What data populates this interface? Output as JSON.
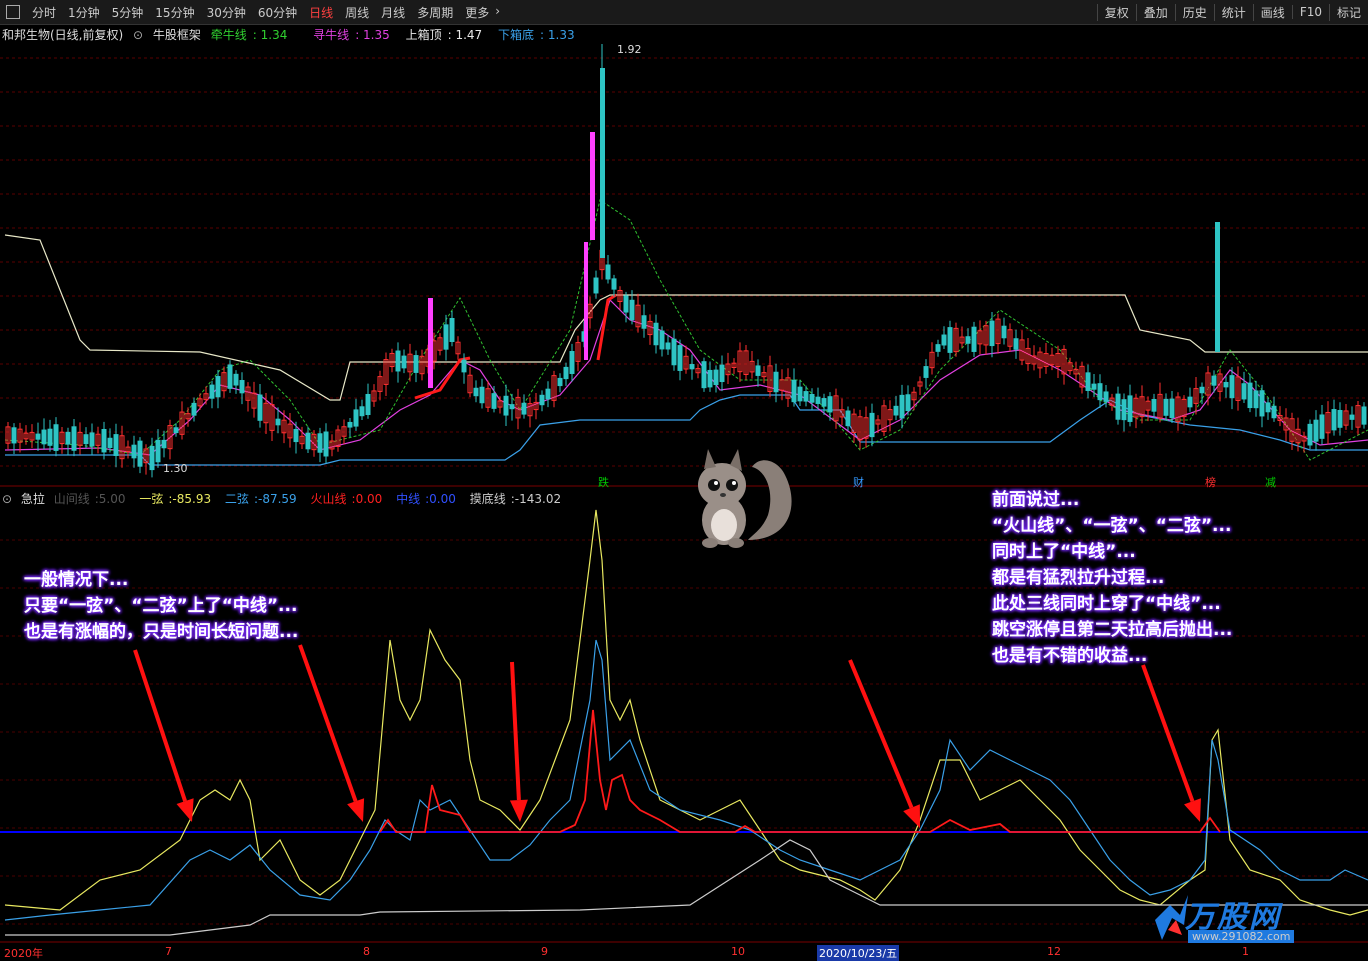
{
  "toolbar": {
    "periods": [
      "分时",
      "1分钟",
      "5分钟",
      "15分钟",
      "30分钟",
      "60分钟",
      "日线",
      "周线",
      "月线",
      "多周期",
      "更多"
    ],
    "active": "日线",
    "right_items": [
      "复权",
      "叠加",
      "历史",
      "统计",
      "画线",
      "F10",
      "标记"
    ]
  },
  "info": {
    "stock": "和邦生物(日线,前复权)",
    "indicator": "牛股框架",
    "l1_name": "牵牛线",
    "l1_val": "1.34",
    "l2_name": "寻牛线",
    "l2_val": "1.35",
    "l3_name": "上箱顶",
    "l3_val": "1.47",
    "l4_name": "下箱底",
    "l4_val": "1.33",
    "high_label": "1.92",
    "low_label": "1.30"
  },
  "indicator": {
    "name": "急拉",
    "a_name": "山间线",
    "a_val": "5.00",
    "b_name": "一弦",
    "b_val": "-85.93",
    "c_name": "二弦",
    "c_val": "-87.59",
    "d_name": "火山线",
    "d_val": "0.00",
    "e_name": "中线",
    "e_val": "0.00",
    "f_name": "摸底线",
    "f_val": "-143.02"
  },
  "marks": [
    {
      "text": "跌",
      "color": "#00cc00"
    },
    {
      "text": "财",
      "color": "#3399ff"
    },
    {
      "text": "榜",
      "color": "#ff3030"
    },
    {
      "text": "减",
      "color": "#00cc00"
    }
  ],
  "dates": [
    "2020年",
    "7",
    "8",
    "9",
    "10",
    "2020/10/23/五",
    "12",
    "1"
  ],
  "annotations": {
    "left": [
      "一般情况下...",
      "只要“一弦”、“二弦”上了“中线”...",
      "也是有涨幅的，只是时间长短问题..."
    ],
    "right": [
      "前面说过...",
      "“火山线”、“一弦”、“二弦”...",
      "同时上了“中线”...",
      "都是有猛烈拉升过程...",
      "此处三线同时上穿了“中线”...",
      "跳空涨停且第二天拉高后抛出...",
      "也是有不错的收益..."
    ]
  },
  "watermark": {
    "text": "万股网",
    "url": "www.291082.com"
  },
  "colors": {
    "up": "#ff3030",
    "down": "#2ec4c4",
    "yellow": "#e8e860",
    "blue": "#3aa0e8",
    "red": "#ff1a1a",
    "midline": "#0000ff",
    "magenta": "#e040e0",
    "green": "#30c030"
  }
}
